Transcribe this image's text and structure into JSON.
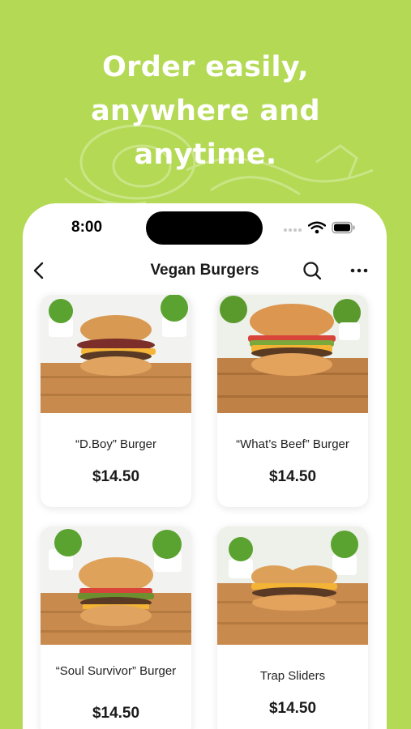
{
  "headline": {
    "line1": "Order easily,",
    "line2": "anywhere and",
    "line3": "anytime."
  },
  "status_bar": {
    "time": "8:00",
    "icons": [
      "signal-dots-icon",
      "wifi-icon",
      "battery-icon"
    ]
  },
  "nav": {
    "title": "Vegan Burgers",
    "icons": [
      "back-icon",
      "search-icon",
      "more-icon"
    ]
  },
  "products": [
    {
      "name": "“D.Boy” Burger",
      "price": "$14.50"
    },
    {
      "name": "“What’s Beef” Burger",
      "price": "$14.50"
    },
    {
      "name": "“Soul Survivor” Burger",
      "price": "$14.50"
    },
    {
      "name": "Trap Sliders",
      "price": "$14.50"
    }
  ],
  "colors": {
    "background": "#b4d955",
    "card": "#ffffff",
    "text": "#1a1a1a"
  }
}
